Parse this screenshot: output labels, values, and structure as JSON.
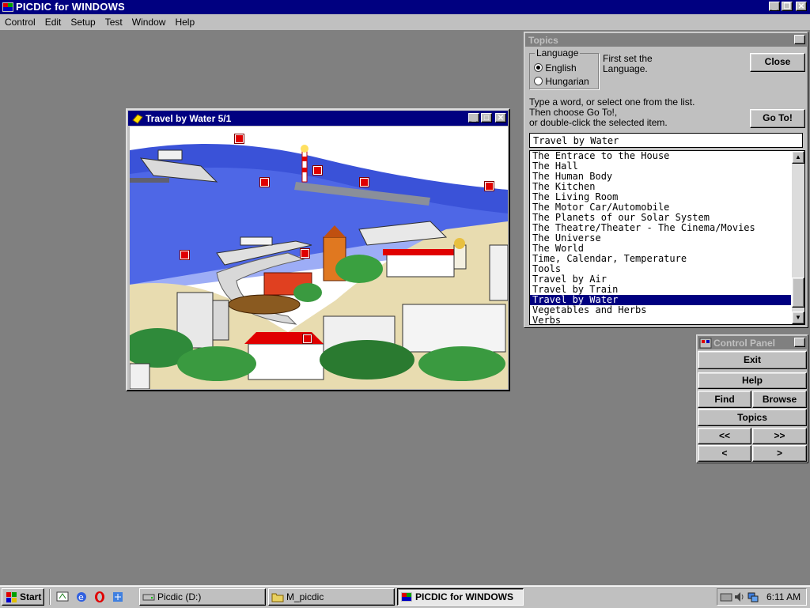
{
  "app": {
    "title": "PICDIC for WINDOWS",
    "menu": [
      "Control",
      "Edit",
      "Setup",
      "Test",
      "Window",
      "Help"
    ]
  },
  "image_window": {
    "title": "Travel by Water 5/1"
  },
  "topics": {
    "title": "Topics",
    "language_label": "Language",
    "language_options": [
      "English",
      "Hungarian"
    ],
    "language_selected": "English",
    "hint1": "First set the Language.",
    "close_label": "Close",
    "instructions": [
      "Type a word, or select one from the list.",
      "Then choose Go To!,",
      "or double-click the selected item."
    ],
    "goto_label": "Go To!",
    "search_value": "Travel by Water",
    "list": [
      "The Entrace to the House",
      "The Hall",
      "The Human Body",
      "The Kitchen",
      "The Living Room",
      "The Motor Car/Automobile",
      "The Planets of our Solar System",
      "The Theatre/Theater - The Cinema/Movies",
      "The Universe",
      "The World",
      "Time, Calendar, Temperature",
      "Tools",
      "Travel by Air",
      "Travel by Train",
      "Travel by Water",
      "Vegetables and Herbs",
      "Verbs"
    ],
    "selected_item": "Travel by Water"
  },
  "control_panel": {
    "title": "Control Panel",
    "exit": "Exit",
    "help": "Help",
    "find": "Find",
    "browse": "Browse",
    "topics": "Topics",
    "first": "<<",
    "last": ">>",
    "prev": "<",
    "next": ">"
  },
  "taskbar": {
    "start": "Start",
    "tasks": [
      "Picdic (D:)",
      "M_picdic",
      "PICDIC for WINDOWS"
    ],
    "active_task": "PICDIC for WINDOWS",
    "clock": "6:11 AM"
  },
  "colors": {
    "title_active": "#000080",
    "title_inactive": "#808080",
    "desktop": "#808080",
    "hotspot": "#e00000",
    "water": "#3a52d8"
  }
}
